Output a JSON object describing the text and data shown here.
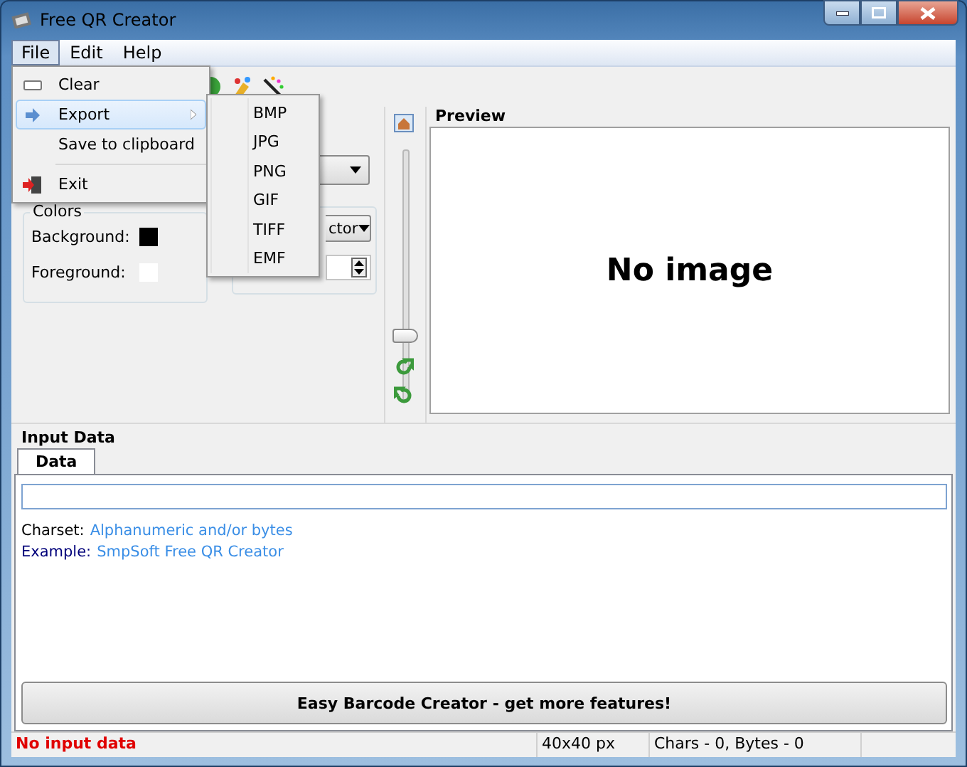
{
  "window": {
    "title": "Free QR Creator"
  },
  "menu_bar": [
    {
      "label": "File",
      "selected": true
    },
    {
      "label": "Edit",
      "selected": false
    },
    {
      "label": "Help",
      "selected": false
    }
  ],
  "file_menu": [
    {
      "kind": "item",
      "label": "Clear",
      "selected": false,
      "submenu": false
    },
    {
      "kind": "item",
      "label": "Export",
      "selected": true,
      "submenu": true
    },
    {
      "kind": "item",
      "label": "Save to clipboard",
      "selected": false,
      "submenu": false
    },
    {
      "kind": "separator"
    },
    {
      "kind": "item",
      "label": "Exit",
      "selected": false,
      "submenu": false
    }
  ],
  "export_submenu": [
    {
      "label": "BMP"
    },
    {
      "label": "JPG"
    },
    {
      "label": "PNG"
    },
    {
      "label": "GIF"
    },
    {
      "label": "TIFF"
    },
    {
      "label": "EMF"
    }
  ],
  "colors": {
    "title": "Colors",
    "rows": [
      {
        "label": "Background:",
        "color": "#000000"
      },
      {
        "label": "Foreground:",
        "color": "#ffffff"
      }
    ]
  },
  "format_dropdown": {
    "value": "ctor"
  },
  "zoom_slider": {
    "level": 0.25
  },
  "preview": {
    "title": "Preview",
    "message": "No image"
  },
  "input_data": {
    "title": "Input Data",
    "tabs": [
      {
        "label": "Data",
        "selected": true
      }
    ],
    "info": [
      {
        "label": "Charset:",
        "value": "Alphanumeric and/or bytes"
      },
      {
        "label": "Example:",
        "value": "SmpSoft Free QR Creator"
      }
    ],
    "promo_button": "Easy Barcode Creator - get more features!"
  },
  "status_bar": {
    "message": "No input data",
    "size": "40x40 px",
    "counts": "Chars - 0, Bytes - 0"
  }
}
